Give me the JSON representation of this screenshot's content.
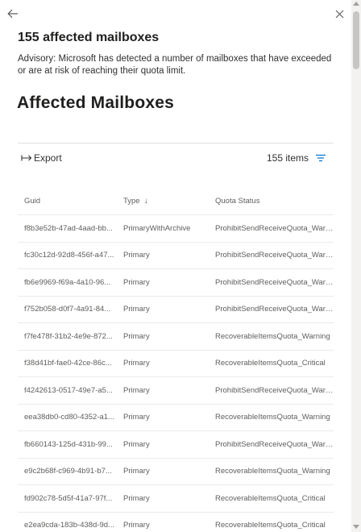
{
  "panel": {
    "title": "155 affected mailboxes",
    "advisory": "Advisory: Microsoft has detected a number of mailboxes that have exceeded or are at risk of reaching their quota limit.",
    "section_title": "Affected Mailboxes"
  },
  "toolbar": {
    "export_label": "Export",
    "item_count": "155 items"
  },
  "icons": {
    "back": "arrow-left-icon",
    "close": "close-icon",
    "export": "export-arrow-icon",
    "filter": "filter-lines-icon",
    "sort": "arrow-down-icon"
  },
  "colors": {
    "accent": "#0078d4",
    "text": "#323130",
    "muted": "#605e5c",
    "divider": "#edebe9"
  },
  "table": {
    "headers": {
      "guid": "Guid",
      "type": "Type",
      "type_sort_glyph": "↓",
      "status": "Quota Status"
    },
    "rows": [
      {
        "guid": "f8b3e52b-47ad-4aad-bb...",
        "type": "PrimaryWithArchive",
        "status": "ProhibitSendReceiveQuota_Warning"
      },
      {
        "guid": "fc30c12d-92d8-456f-a47...",
        "type": "Primary",
        "status": "ProhibitSendReceiveQuota_Warning"
      },
      {
        "guid": "fb6e9969-f69a-4a10-96...",
        "type": "Primary",
        "status": "ProhibitSendReceiveQuota_Warning"
      },
      {
        "guid": "f752b058-d0f7-4a91-84...",
        "type": "Primary",
        "status": "ProhibitSendReceiveQuota_Warning"
      },
      {
        "guid": "f7fe478f-31b2-4e9e-872...",
        "type": "Primary",
        "status": "RecoverableItemsQuota_Warning"
      },
      {
        "guid": "f38d41bf-fae0-42ce-86c...",
        "type": "Primary",
        "status": "RecoverableItemsQuota_Critical"
      },
      {
        "guid": "f4242613-0517-49e7-a5...",
        "type": "Primary",
        "status": "ProhibitSendReceiveQuota_Warning"
      },
      {
        "guid": "eea38db0-cd80-4352-a1...",
        "type": "Primary",
        "status": "RecoverableItemsQuota_Warning"
      },
      {
        "guid": "fb660143-125d-431b-99...",
        "type": "Primary",
        "status": "ProhibitSendReceiveQuota_Warning"
      },
      {
        "guid": "e9c2b68f-c969-4b91-b7...",
        "type": "Primary",
        "status": "RecoverableItemsQuota_Warning"
      },
      {
        "guid": "fd902c78-5d5f-41a7-97f...",
        "type": "Primary",
        "status": "RecoverableItemsQuota_Critical"
      },
      {
        "guid": "e2ea9cda-183b-438d-9d...",
        "type": "Primary",
        "status": "RecoverableItemsQuota_Critical"
      }
    ]
  }
}
